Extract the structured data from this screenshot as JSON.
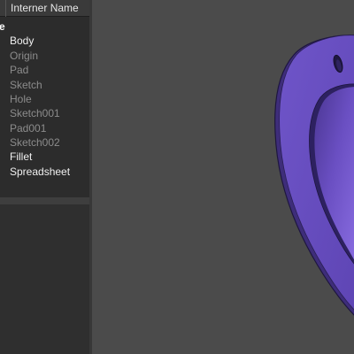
{
  "tree": {
    "header": {
      "column_label": "Interner Name"
    },
    "root_label_fragment": "e",
    "items": [
      {
        "label": "Body",
        "state": "active"
      },
      {
        "label": "Origin",
        "state": "inactive"
      },
      {
        "label": "Pad",
        "state": "inactive"
      },
      {
        "label": "Sketch",
        "state": "inactive"
      },
      {
        "label": "Hole",
        "state": "inactive"
      },
      {
        "label": "Sketch001",
        "state": "inactive"
      },
      {
        "label": "Pad001",
        "state": "inactive"
      },
      {
        "label": "Sketch002",
        "state": "inactive"
      },
      {
        "label": "Fillet",
        "state": "active"
      },
      {
        "label": "Spreadsheet",
        "state": "active"
      }
    ]
  },
  "viewport": {
    "model_color": "#6b4fc4",
    "background_color": "#4b4b4b"
  }
}
